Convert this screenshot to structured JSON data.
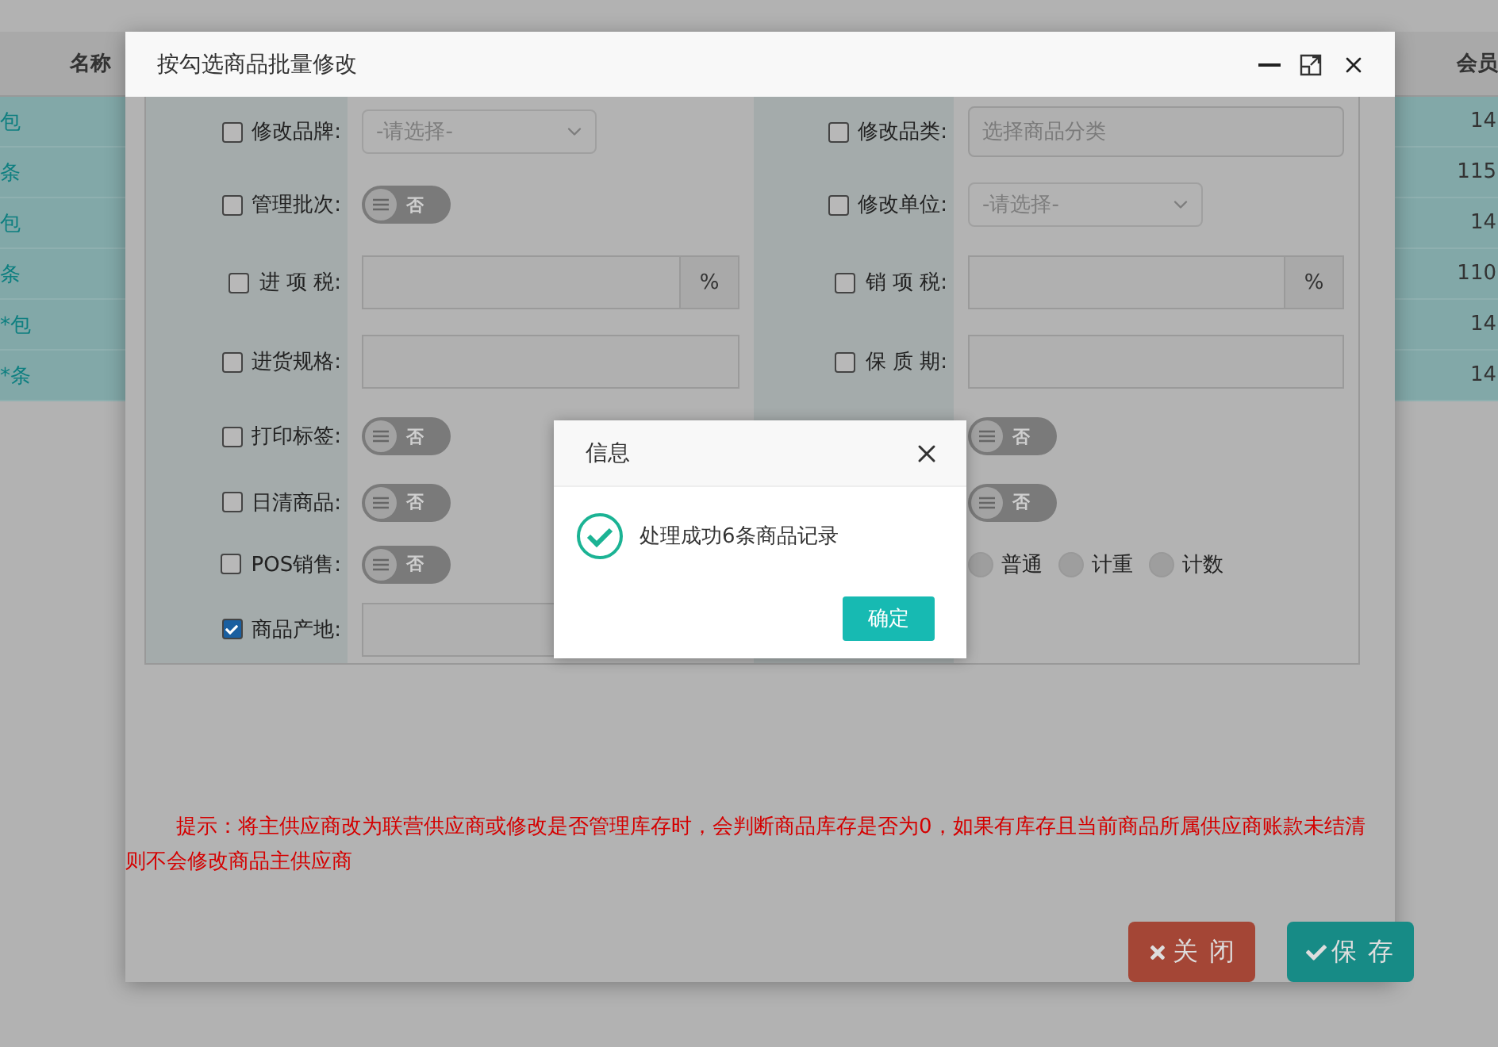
{
  "background_table": {
    "columns": [
      {
        "label": "名称"
      },
      {
        "label": "会员"
      }
    ],
    "rows": [
      {
        "name": "包",
        "price": "14"
      },
      {
        "name": "条",
        "price": "115"
      },
      {
        "name": "包",
        "price": "14"
      },
      {
        "name": "条",
        "price": "110"
      },
      {
        "name": "*包",
        "price": "14"
      },
      {
        "name": "*条",
        "price": "14"
      }
    ]
  },
  "dialog": {
    "title": "按勾选商品批量修改",
    "rows": [
      {
        "left": {
          "label": "修改品牌:",
          "checked": false,
          "kind": "select",
          "value": "-请选择-"
        },
        "right": {
          "label": "修改品类:",
          "checked": false,
          "kind": "text",
          "placeholder": "选择商品分类"
        }
      },
      {
        "left": {
          "label": "管理批次:",
          "checked": false,
          "kind": "toggle",
          "on": false,
          "text": "否"
        },
        "right": {
          "label": "修改单位:",
          "checked": false,
          "kind": "select",
          "value": "-请选择-"
        }
      },
      {
        "left": {
          "label": "进 项 税:",
          "checked": false,
          "kind": "percent",
          "unit": "%"
        },
        "right": {
          "label": "销 项 税:",
          "checked": false,
          "kind": "percent",
          "unit": "%"
        }
      },
      {
        "left": {
          "label": "进货规格:",
          "checked": false,
          "kind": "text"
        },
        "right": {
          "label": "保 质 期:",
          "checked": false,
          "kind": "text"
        }
      },
      {
        "left": {
          "label": "打印标签:",
          "checked": false,
          "kind": "toggle",
          "on": false,
          "text": "否"
        },
        "right": {
          "kind": "toggle",
          "on": false,
          "text": "否"
        }
      },
      {
        "left": {
          "label": "日清商品:",
          "checked": false,
          "kind": "toggle",
          "on": false,
          "text": "否"
        },
        "right": {
          "kind": "toggle",
          "on": false,
          "text": "否"
        }
      },
      {
        "left": {
          "label": "POS销售:",
          "checked": false,
          "kind": "toggle",
          "on": false,
          "text": "否"
        },
        "right": {
          "kind": "radio",
          "options": [
            {
              "label": "普通",
              "selected": false
            },
            {
              "label": "计重",
              "selected": false
            },
            {
              "label": "计数",
              "selected": false
            }
          ]
        }
      },
      {
        "left": {
          "label": "商品产地:",
          "checked": true,
          "kind": "text"
        },
        "right": {
          "kind": "empty"
        }
      }
    ],
    "hint": "提示：将主供应商改为联营供应商或修改是否管理库存时，会判断商品库存是否为0，如果有库存且当前商品所属供应商账款未结清则不会修改商品主供应商",
    "buttons": [
      {
        "label": "关 闭",
        "kind": "close"
      },
      {
        "label": "保 存",
        "kind": "save"
      }
    ]
  },
  "message": {
    "title": "信息",
    "text": "处理成功6条商品记录",
    "button": "确定"
  }
}
